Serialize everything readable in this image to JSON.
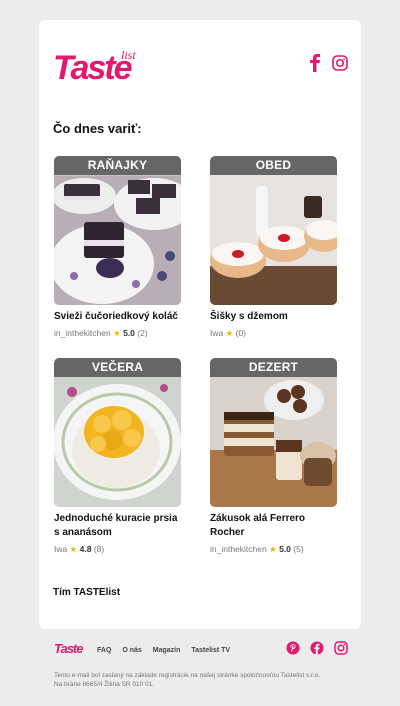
{
  "brand": {
    "logo_main": "Taste",
    "logo_sub": "list",
    "footer_logo": "Taste"
  },
  "header": {
    "heading": "Čo dnes variť:"
  },
  "recipes": [
    {
      "category": "RAŇAJKY",
      "title": "Svieži čučoriedkový koláč",
      "author": "in_inthekitchen",
      "rating": "5.0",
      "count": "(2)",
      "photo": "blueberry-cake"
    },
    {
      "category": "OBED",
      "title": "Šišky s džemom",
      "author": "Iwa",
      "rating": "",
      "count": "(0)",
      "photo": "donuts"
    },
    {
      "category": "VEČERA",
      "title": "Jednoduché kuracie prsia s ananásom",
      "author": "Iwa",
      "rating": "4.8",
      "count": "(8)",
      "photo": "chicken-pineapple"
    },
    {
      "category": "DEZERT",
      "title": "Zákusok alá Ferrero Rocher",
      "author": "in_inthekitchen",
      "rating": "5.0",
      "count": "(5)",
      "photo": "ferrero-dessert"
    }
  ],
  "signature": "Tím TASTElist",
  "footer": {
    "links": [
      "FAQ",
      "O nás",
      "Magazín",
      "Tastelist TV"
    ],
    "disclaimer": "Tento e-mail bol zaslaný na základe registrácie na našej stránke spoločnosťou Tastelist s.r.o. Na bráne 8665/4 Žilina SR 010 01."
  },
  "colors": {
    "brand": "#e5176e",
    "category_bar": "#666666",
    "star": "#f4b400",
    "background": "#ececec"
  },
  "icons": [
    "facebook-icon",
    "instagram-icon",
    "pinterest-icon",
    "star-icon"
  ]
}
